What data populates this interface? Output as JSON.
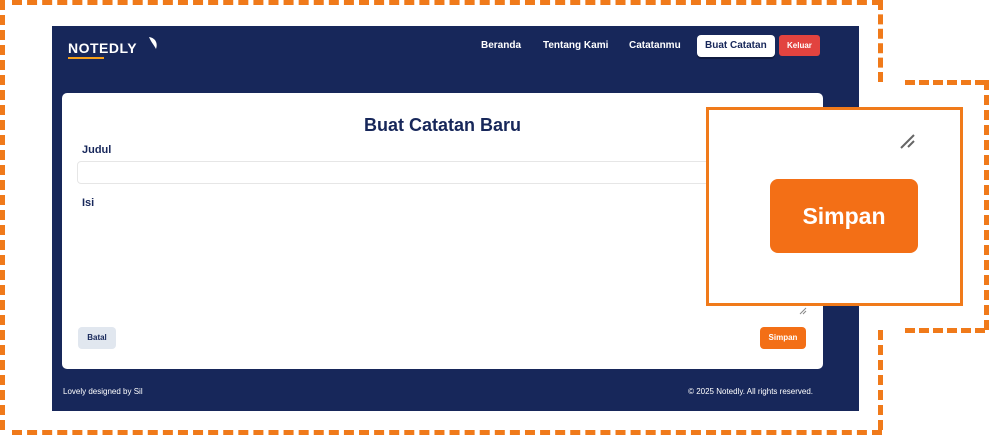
{
  "header": {
    "logo_text": "NOTEDLY",
    "nav": [
      {
        "label": "Beranda"
      },
      {
        "label": "Tentang Kami"
      },
      {
        "label": "Catatanmu"
      },
      {
        "label": "Buat Catatan"
      }
    ],
    "logout_label": "Keluar"
  },
  "form": {
    "title": "Buat Catatan Baru",
    "title_label": "Judul",
    "title_value": "",
    "content_label": "Isi",
    "content_value": "",
    "cancel_label": "Batal",
    "save_label": "Simpan"
  },
  "footer": {
    "left": "Lovely designed by Sil",
    "right": "© 2025 Notedly. All rights reserved."
  },
  "zoom": {
    "save_label": "Simpan"
  },
  "colors": {
    "navy": "#17275a",
    "accent": "#f36f16",
    "logout": "#e2433f"
  }
}
